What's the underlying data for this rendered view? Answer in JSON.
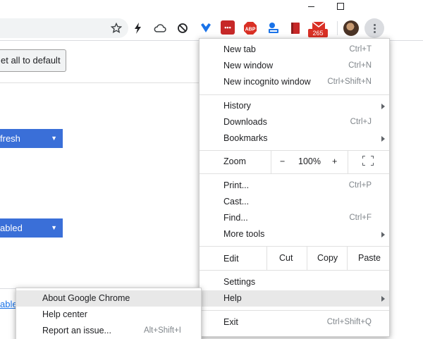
{
  "toolbar": {
    "badge_count": "265",
    "extensions": [
      {
        "name": "bolt-icon",
        "color": "#202124"
      },
      {
        "name": "cloud-icon",
        "color": "#5f6368"
      },
      {
        "name": "block-icon",
        "color": "#202124"
      },
      {
        "name": "heart-shield-icon",
        "color": "#1a73e8"
      },
      {
        "name": "ellipsis-extension-icon",
        "color": "#d93025"
      },
      {
        "name": "abp-icon",
        "color": "#d93025",
        "text": "ABP"
      },
      {
        "name": "a-translate-icon",
        "color": "#1a73e8"
      },
      {
        "name": "bookmark-red-icon",
        "color": "#c62828"
      },
      {
        "name": "mail-icon",
        "color": "#d93025"
      }
    ]
  },
  "page": {
    "reset_label": "et all to default",
    "select1_label": "fresh",
    "select2_label": "abled",
    "link_label": "able"
  },
  "menu": {
    "new_tab": {
      "label": "New tab",
      "shortcut": "Ctrl+T"
    },
    "new_window": {
      "label": "New window",
      "shortcut": "Ctrl+N"
    },
    "new_incognito": {
      "label": "New incognito window",
      "shortcut": "Ctrl+Shift+N"
    },
    "history": {
      "label": "History"
    },
    "downloads": {
      "label": "Downloads",
      "shortcut": "Ctrl+J"
    },
    "bookmarks": {
      "label": "Bookmarks"
    },
    "zoom": {
      "label": "Zoom",
      "minus": "−",
      "level": "100%",
      "plus": "+"
    },
    "print": {
      "label": "Print...",
      "shortcut": "Ctrl+P"
    },
    "cast": {
      "label": "Cast..."
    },
    "find": {
      "label": "Find...",
      "shortcut": "Ctrl+F"
    },
    "more_tools": {
      "label": "More tools"
    },
    "edit": {
      "label": "Edit",
      "cut": "Cut",
      "copy": "Copy",
      "paste": "Paste"
    },
    "settings": {
      "label": "Settings"
    },
    "help": {
      "label": "Help"
    },
    "exit": {
      "label": "Exit",
      "shortcut": "Ctrl+Shift+Q"
    }
  },
  "help_submenu": {
    "about": {
      "label": "About Google Chrome"
    },
    "help_center": {
      "label": "Help center"
    },
    "report_issue": {
      "label": "Report an issue...",
      "shortcut": "Alt+Shift+I"
    }
  }
}
